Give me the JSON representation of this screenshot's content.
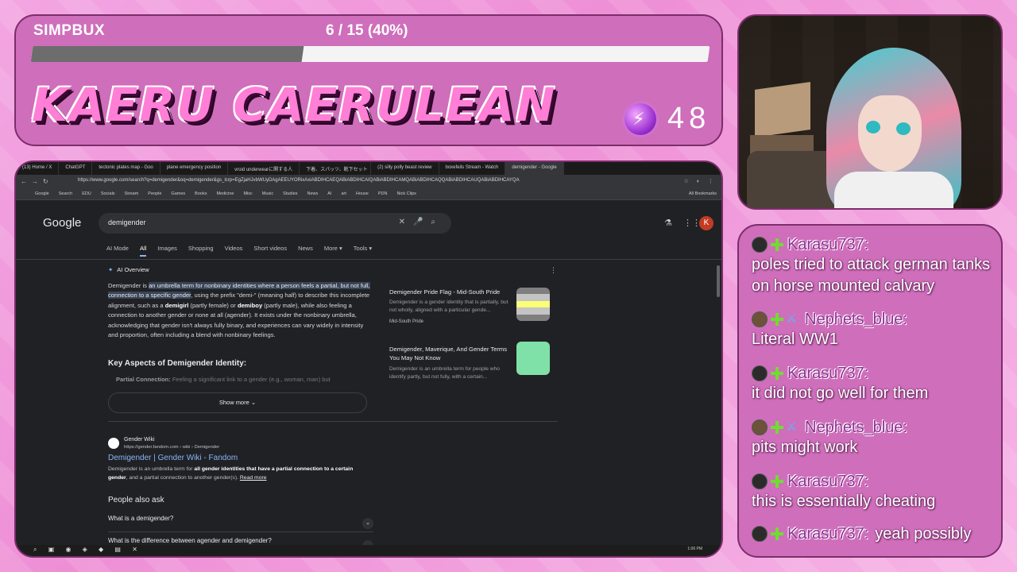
{
  "header": {
    "bux_label": "SIMPBUX",
    "bux_count": "6 / 15 (40%)",
    "progress_fraction": 0.4,
    "streamer_name": "KAERU CAERULEAN",
    "coin_count": "48"
  },
  "browser": {
    "tabs": [
      "(13) Home / X",
      "ChatGPT",
      "tectonic plates map - Goo",
      "plane emergency position",
      "vroid underwearに関する人",
      "下着、スパッツ、靴下セット",
      "(2) silly polly beast review",
      "boxefeils Stream - Watch",
      "demigender - Google"
    ],
    "active_tab": 8,
    "url": "https://www.google.com/search?q=demigender&oq=demigender&gs_lcrp=EgZjaHJvbWUyDAgAEEUYORixAxiABDIHCAEQABiABDIHCAIQABiABDIHCAMQABiABDIHCAQQABiABDIHCAUQABiABDIHCAYQA",
    "bookmarks": [
      "Google",
      "Search",
      "EDU",
      "Socials",
      "Stream",
      "People",
      "Games",
      "Books",
      "Medicine",
      "Misc",
      "Music",
      "Studies",
      "News",
      "AI",
      "art",
      "House",
      "PDN",
      "Nick Clips"
    ],
    "all_bookmarks": "All Bookmarks",
    "google_logo": "Google",
    "search_query": "demigender",
    "profile_initial": "K",
    "nav": [
      "AI Mode",
      "All",
      "Images",
      "Shopping",
      "Videos",
      "Short videos",
      "News",
      "More ▾",
      "Tools ▾"
    ],
    "ai": {
      "title": "AI Overview",
      "p_start": "Demigender is ",
      "p_hl": "an umbrella term for nonbinary identities where a person feels a partial, but not full, connection to a specific gender",
      "p_mid1": ", using the prefix \"demi-\" (meaning half) to describe this incomplete alignment, such as a ",
      "demigirl": "demigirl",
      "p_mid2": " (partly female) or ",
      "demiboy": "demiboy",
      "p_mid3": " (partly male), while also feeling a connection to another gender or none at all (agender). It exists under the nonbinary umbrella, acknowledging that gender isn't always fully binary, and experiences can vary widely in intensity and proportion, often including a blend with nonbinary feelings.",
      "subheading": "Key Aspects of Demigender Identity:",
      "faded_bold": "Partial Connection:",
      "faded_text": " Feeling a significant link to a gender (e.g., woman, man) but",
      "show_more": "Show more"
    },
    "sources": [
      {
        "title": "Demigender Pride Flag - Mid-South Pride",
        "snippet": "Demigender is a gender identity that is partially, but not wholly, aligned with a particular gende...",
        "site": "Mid-South Pride"
      },
      {
        "title": "Demigender, Maverique, And Gender Terms You May Not Know",
        "snippet": "Demigender is an umbrella term for people who identify partly, but not fully, with a certain...",
        "site": ""
      }
    ],
    "result": {
      "site": "Gender Wiki",
      "crumb": "https://gender.fandom.com › wiki › Demigender",
      "title": "Demigender | Gender Wiki - Fandom",
      "snip1": "Demigender is an umbrella term for ",
      "snip_bold": "all gender identities that have a partial connection to a certain gender",
      "snip2": ", and a partial connection to another gender(s).",
      "read_more": "Read more"
    },
    "paa": {
      "title": "People also ask",
      "questions": [
        "What is a demigender?",
        "What is the difference between agender and demigender?"
      ]
    },
    "clock": "1:06 PM"
  },
  "chat": [
    {
      "user": "Karasu737:",
      "badges": [
        "plus"
      ],
      "text": "poles tried to attack german tanks on horse mounted calvary"
    },
    {
      "user": "Nephets_blue:",
      "badges": [
        "plus",
        "sword"
      ],
      "text": "Literal WW1"
    },
    {
      "user": "Karasu737:",
      "badges": [
        "plus"
      ],
      "text": "it did not go well for them"
    },
    {
      "user": "Nephets_blue:",
      "badges": [
        "plus",
        "sword"
      ],
      "text": "pits might work"
    },
    {
      "user": "Karasu737:",
      "badges": [
        "plus"
      ],
      "text": "this is essentially cheating"
    },
    {
      "user": "Karasu737:",
      "badges": [
        "plus"
      ],
      "text": "yeah possibly"
    }
  ],
  "colors": {
    "background": "#ee8fd6",
    "panel": "#cf6ebb",
    "progress_fill": "#6d6d6d",
    "link": "#8ab4f8"
  }
}
